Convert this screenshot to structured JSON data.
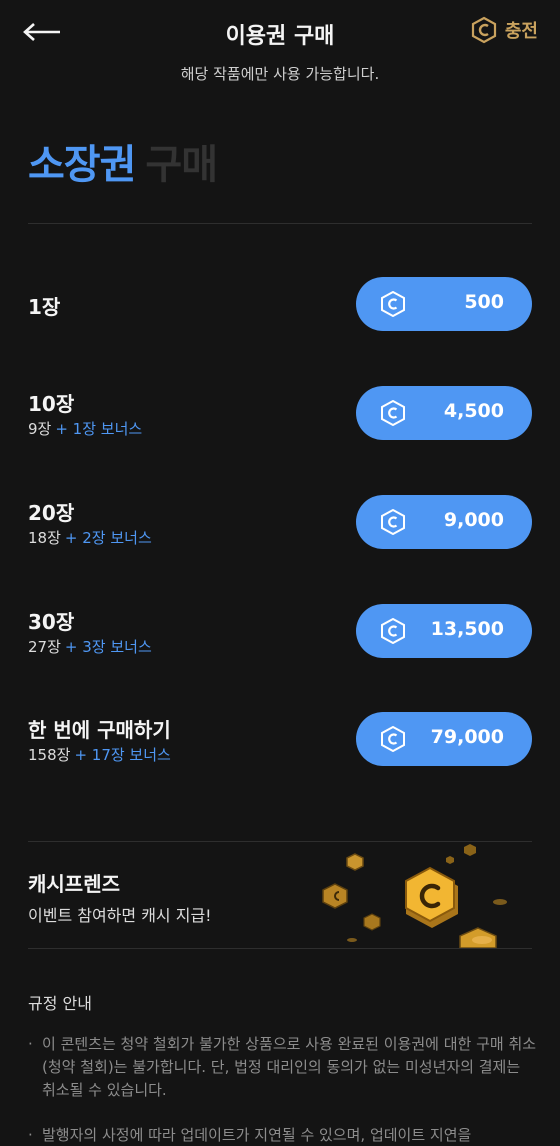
{
  "header": {
    "title": "이용권 구매",
    "charge_label": "충전"
  },
  "subtitle": "해당 작품에만 사용 가능합니다.",
  "heading": {
    "accent": "소장권",
    "dim": "구매"
  },
  "colors": {
    "accent": "#4f97f3",
    "coin_gold": "#c9a25e",
    "background": "#141414"
  },
  "tickets": [
    {
      "name": "1장",
      "base": "",
      "bonus": "",
      "price": "500"
    },
    {
      "name": "10장",
      "base": "9장",
      "bonus": "+ 1장 보너스",
      "price": "4,500"
    },
    {
      "name": "20장",
      "base": "18장",
      "bonus": "+ 2장 보너스",
      "price": "9,000"
    },
    {
      "name": "30장",
      "base": "27장",
      "bonus": "+ 3장 보너스",
      "price": "13,500"
    },
    {
      "name": "한 번에 구매하기",
      "base": "158장",
      "bonus": "+ 17장 보너스",
      "price": "79,000"
    }
  ],
  "event": {
    "title": "캐시프렌즈",
    "desc": "이벤트 참여하면 캐시 지급!"
  },
  "rules": {
    "title": "규정 안내",
    "items": [
      "이 콘텐츠는 청약 철회가 불가한 상품으로 사용 완료된 이용권에 대한 구매 취소(청약 철회)는 불가합니다. 단, 법정 대리인의 동의가 없는 미성년자의 결제는 취소될 수 있습니다.",
      "발행자의 사정에 따라 업데이트가 지연될 수 있으며, 업데이트 지연을"
    ]
  }
}
